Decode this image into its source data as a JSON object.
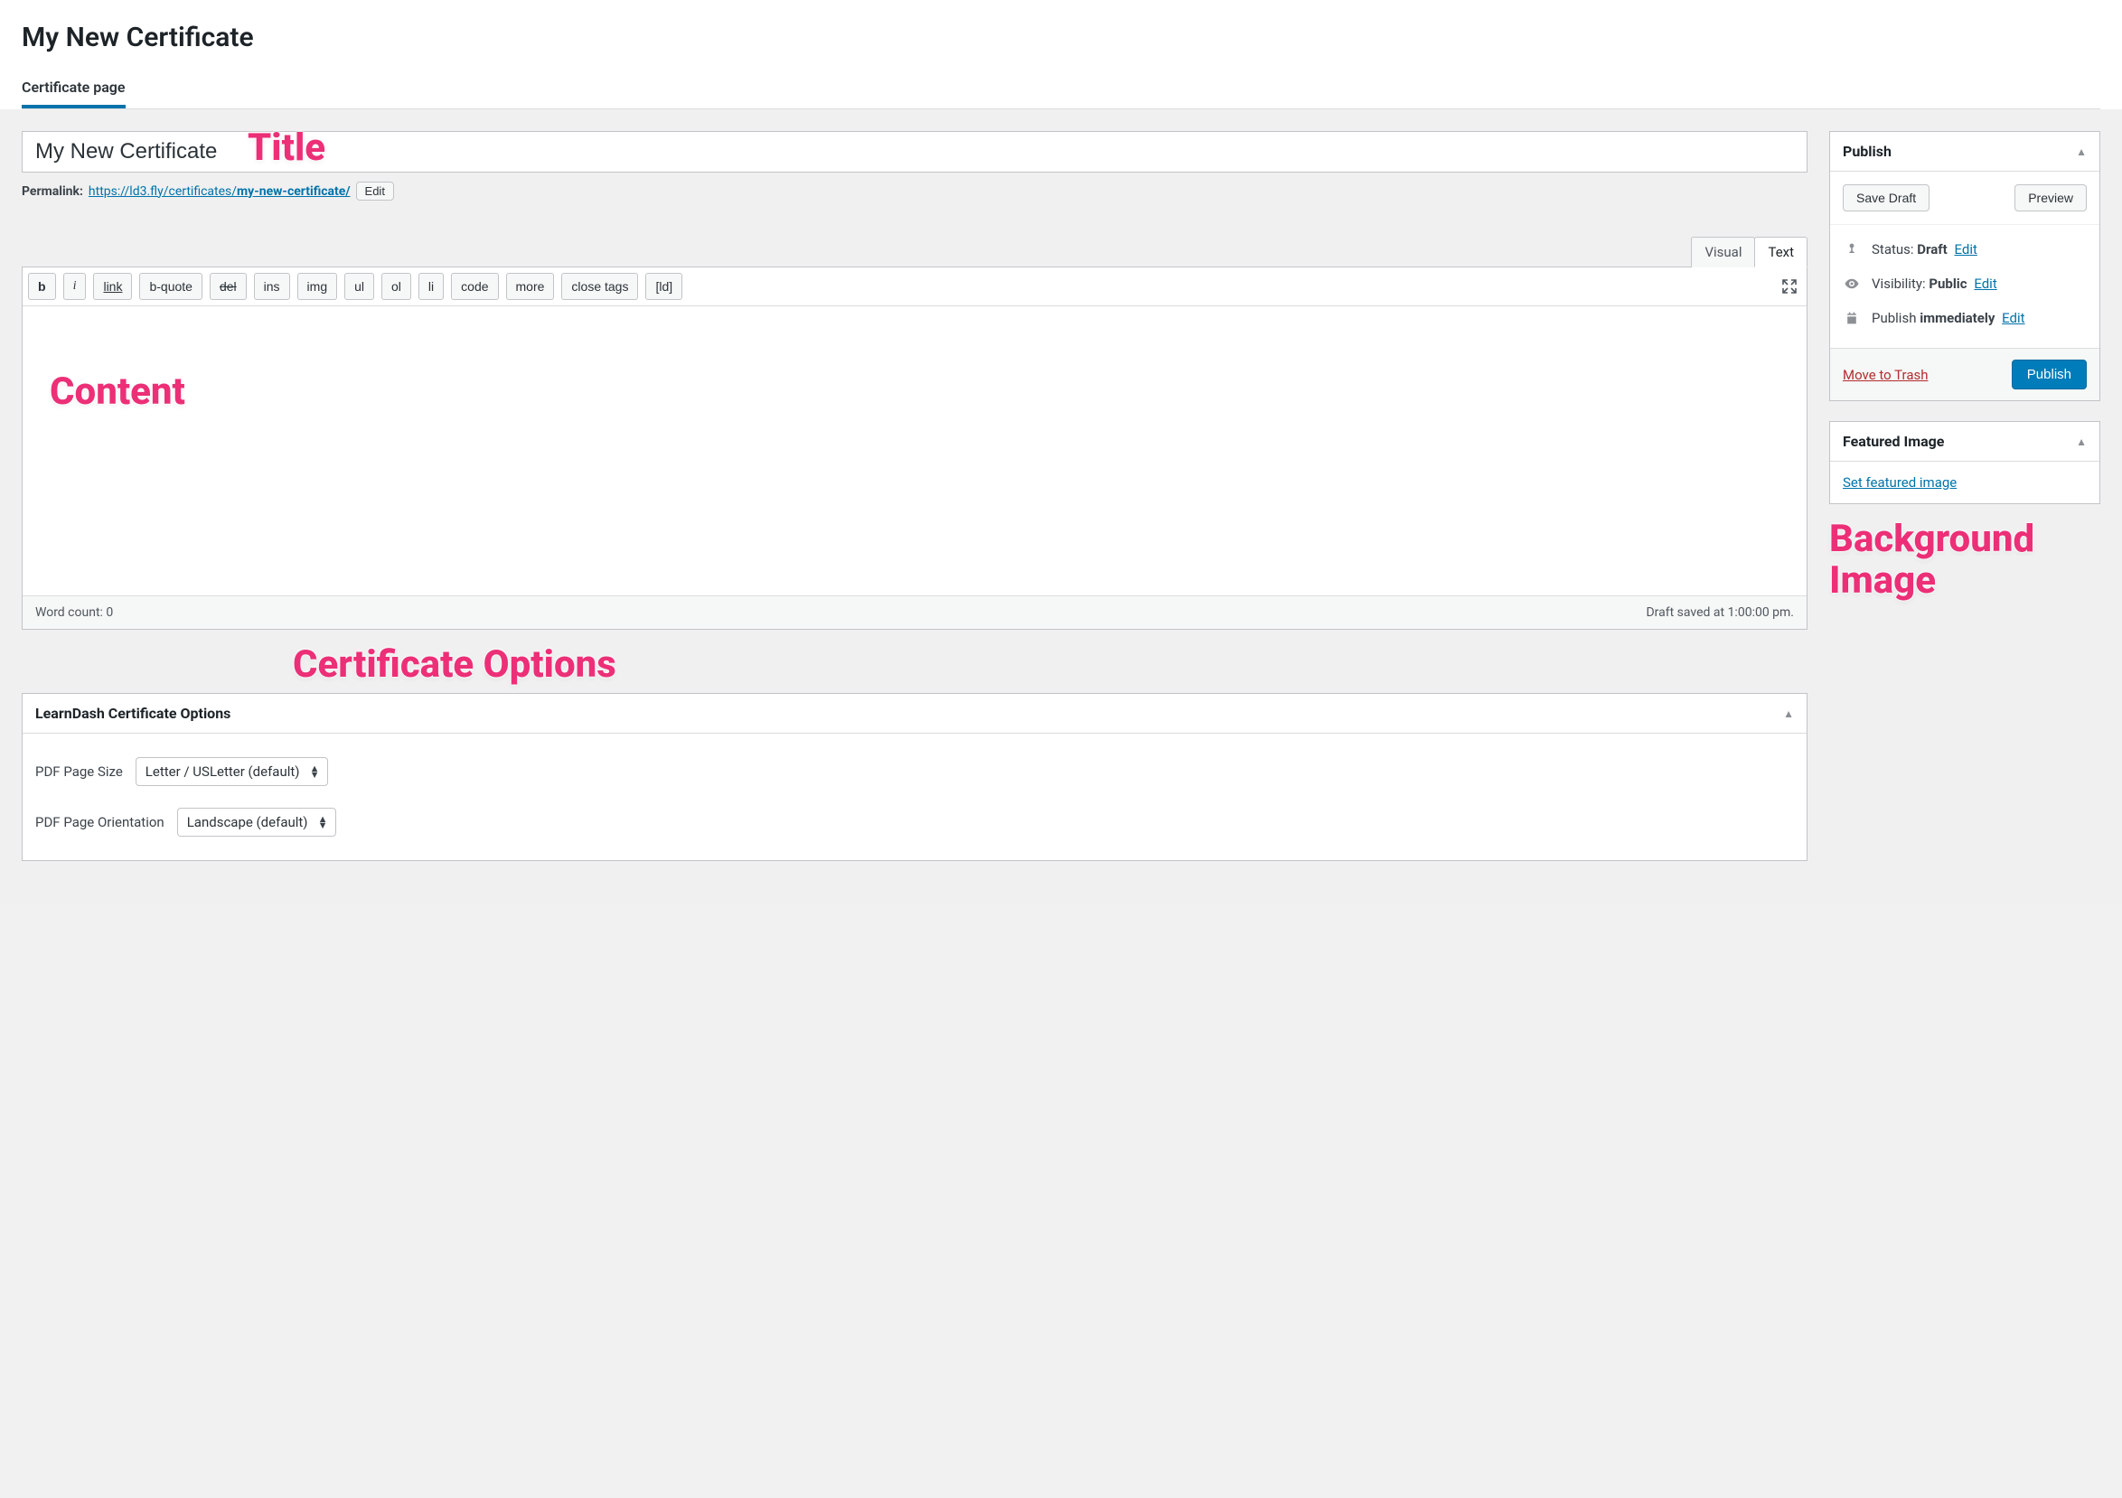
{
  "page_title": "My New Certificate",
  "nav_tab": "Certificate page",
  "title_input": "My New Certificate",
  "permalink": {
    "label": "Permalink:",
    "base": "https://ld3.fly/certificates/",
    "slug": "my-new-certificate/",
    "edit": "Edit"
  },
  "annotations": {
    "title": "Title",
    "content": "Content",
    "cert_options": "Certificate Options",
    "bg_image_l1": "Background",
    "bg_image_l2": "Image"
  },
  "editor": {
    "tab_visual": "Visual",
    "tab_text": "Text",
    "buttons": {
      "b": "b",
      "i": "i",
      "link": "link",
      "bquote": "b-quote",
      "del": "del",
      "ins": "ins",
      "img": "img",
      "ul": "ul",
      "ol": "ol",
      "li": "li",
      "code": "code",
      "more": "more",
      "close": "close tags",
      "ld": "[ld]"
    },
    "word_count": "Word count: 0",
    "draft_saved": "Draft saved at 1:00:00 pm."
  },
  "publish": {
    "heading": "Publish",
    "save_draft": "Save Draft",
    "preview": "Preview",
    "status_label": "Status:",
    "status_value": "Draft",
    "visibility_label": "Visibility:",
    "visibility_value": "Public",
    "schedule_label": "Publish",
    "schedule_value": "immediately",
    "edit": "Edit",
    "trash": "Move to Trash",
    "publish_btn": "Publish"
  },
  "featured": {
    "heading": "Featured Image",
    "link": "Set featured image"
  },
  "cert": {
    "heading": "LearnDash Certificate Options",
    "size_label": "PDF Page Size",
    "size_value": "Letter / USLetter (default)",
    "orient_label": "PDF Page Orientation",
    "orient_value": "Landscape (default)"
  }
}
